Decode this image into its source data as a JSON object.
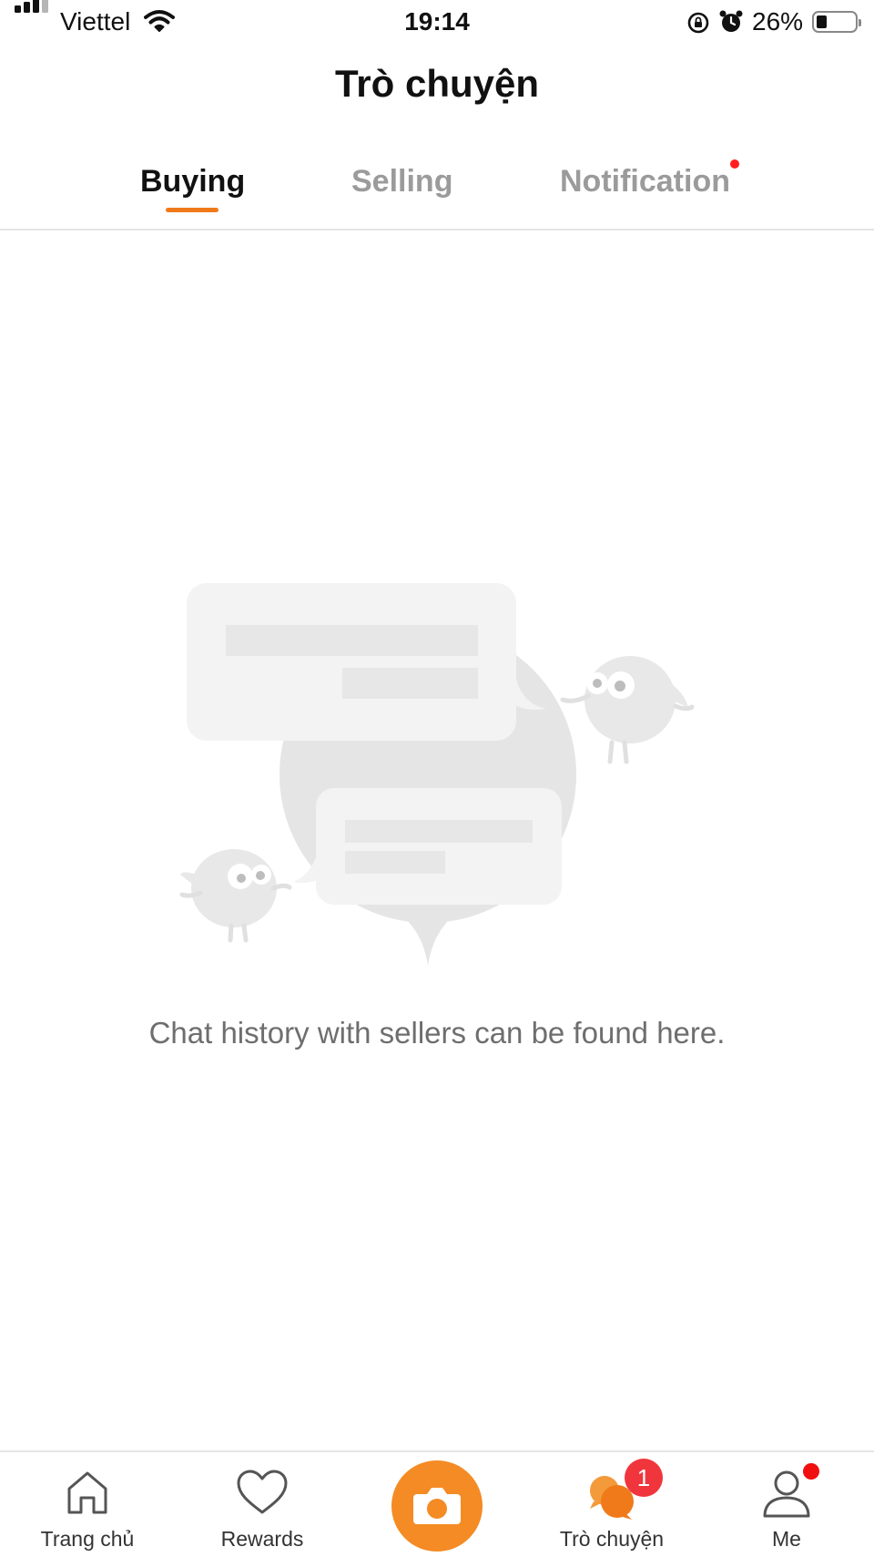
{
  "status_bar": {
    "carrier": "Viettel",
    "time": "19:14",
    "battery_percent": "26%",
    "battery_level": 0.26
  },
  "header": {
    "title": "Trò chuyện"
  },
  "tabs": [
    {
      "label": "Buying",
      "active": true
    },
    {
      "label": "Selling",
      "active": false
    },
    {
      "label": "Notification",
      "active": false,
      "has_dot": true
    }
  ],
  "empty_state": {
    "illustration": "chat-bubbles-birds-illustration",
    "message": "Chat history with sellers can be found here."
  },
  "bottom_nav": [
    {
      "label": "Trang chủ",
      "icon": "home-icon",
      "active": false
    },
    {
      "label": "Rewards",
      "icon": "heart-icon",
      "active": false
    },
    {
      "label": "",
      "icon": "camera-icon",
      "active": false
    },
    {
      "label": "Trò chuyện",
      "icon": "chat-icon",
      "active": true,
      "badge": "1"
    },
    {
      "label": "Me",
      "icon": "user-icon",
      "active": false,
      "dot": true
    }
  ],
  "colors": {
    "accent": "#f07a1a",
    "badge": "#f0363c",
    "notification_dot": "#ff1f1f"
  }
}
